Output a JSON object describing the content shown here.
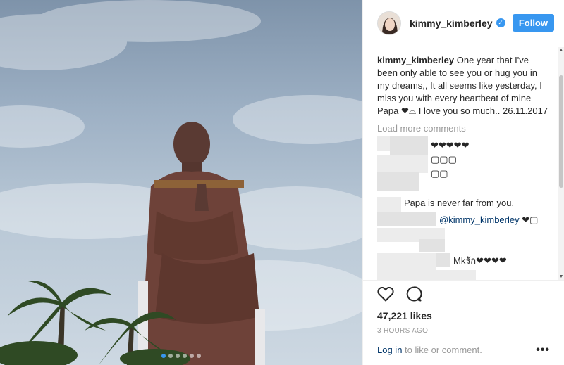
{
  "post": {
    "username": "kimmy_kimberley",
    "verified": true,
    "follow_label": "Follow"
  },
  "caption": {
    "username": "kimmy_kimberley",
    "text": "One year that I've been only able to see you or hug you in my dreams,, It all seems like yesterday, I miss you with every heartbeat of mine Papa ❤⌓ I love you so much.. 26.11.2017"
  },
  "load_more_label": "Load more comments",
  "comments": [
    {
      "text": "❤❤❤❤❤"
    },
    {
      "text": "▢▢▢"
    },
    {
      "text": "▢▢"
    },
    {
      "text": "Papa is never far from you."
    },
    {
      "mention": "@kimmy_kimberley",
      "text": "❤▢"
    },
    {
      "text": "Mkรัก❤❤❤❤"
    },
    {
      "text": "▢▢▢▢"
    }
  ],
  "likes_label": "47,221 likes",
  "time_label": "3 HOURS AGO",
  "login": {
    "link_label": "Log in",
    "rest_label": " to like or comment.",
    "more_label": "•••"
  },
  "carousel": {
    "count": 6,
    "active": 0
  },
  "icons": {
    "like": "heart-icon",
    "comment": "comment-bubble-icon",
    "verified": "verified-badge-icon",
    "more": "more-options-icon"
  },
  "colors": {
    "accent": "#3897f0",
    "link": "#003569",
    "muted": "#999999"
  }
}
